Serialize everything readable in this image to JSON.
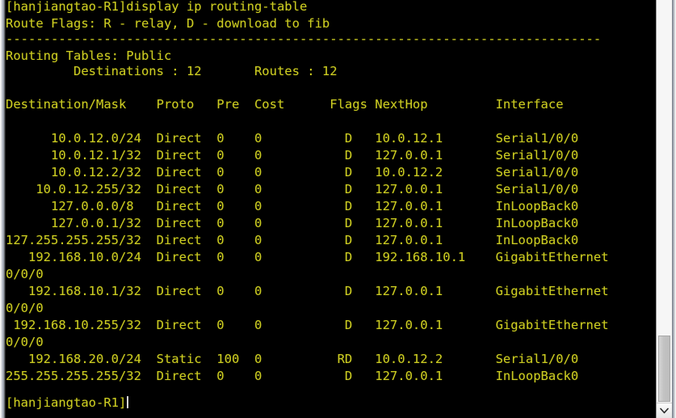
{
  "window": {
    "background_color": "#000000",
    "text_color": "#cccc22",
    "scrollbar_face_color": "#c2c2c2"
  },
  "console": {
    "prompt_command_line": "[hanjiangtao-R1]display ip routing-table",
    "route_flags_line": "Route Flags: R - relay, D - download to fib",
    "separator_line": "-------------------------------------------------------------------------------",
    "routing_tables_line": "Routing Tables: Public",
    "summary_line": "         Destinations : 12       Routes : 12",
    "header_line": "Destination/Mask    Proto   Pre  Cost      Flags NextHop         Interface",
    "trailing_prompt": "[hanjiangtao-R1]",
    "body_lines": [
      "      10.0.12.0/24  Direct  0    0           D   10.0.12.1       Serial1/0/0",
      "      10.0.12.1/32  Direct  0    0           D   127.0.0.1       Serial1/0/0",
      "      10.0.12.2/32  Direct  0    0           D   10.0.12.2       Serial1/0/0",
      "    10.0.12.255/32  Direct  0    0           D   127.0.0.1       Serial1/0/0",
      "      127.0.0.0/8   Direct  0    0           D   127.0.0.1       InLoopBack0",
      "      127.0.0.1/32  Direct  0    0           D   127.0.0.1       InLoopBack0",
      "127.255.255.255/32  Direct  0    0           D   127.0.0.1       InLoopBack0",
      "   192.168.10.0/24  Direct  0    0           D   192.168.10.1    GigabitEthernet",
      "0/0/0",
      "   192.168.10.1/32  Direct  0    0           D   127.0.0.1       GigabitEthernet",
      "0/0/0",
      " 192.168.10.255/32  Direct  0    0           D   127.0.0.1       GigabitEthernet",
      "0/0/0",
      "   192.168.20.0/24  Static  100  0          RD   10.0.12.2       Serial1/0/0",
      "255.255.255.255/32  Direct  0    0           D   127.0.0.1       InLoopBack0"
    ]
  },
  "routing_table": {
    "columns": [
      "Destination/Mask",
      "Proto",
      "Pre",
      "Cost",
      "Flags",
      "NextHop",
      "Interface"
    ],
    "destinations_count": "12",
    "routes_count": "12",
    "rows": [
      {
        "destination": "10.0.12.0/24",
        "proto": "Direct",
        "pre": "0",
        "cost": "0",
        "flags": "D",
        "nexthop": "10.0.12.1",
        "interface": "Serial1/0/0"
      },
      {
        "destination": "10.0.12.1/32",
        "proto": "Direct",
        "pre": "0",
        "cost": "0",
        "flags": "D",
        "nexthop": "127.0.0.1",
        "interface": "Serial1/0/0"
      },
      {
        "destination": "10.0.12.2/32",
        "proto": "Direct",
        "pre": "0",
        "cost": "0",
        "flags": "D",
        "nexthop": "10.0.12.2",
        "interface": "Serial1/0/0"
      },
      {
        "destination": "10.0.12.255/32",
        "proto": "Direct",
        "pre": "0",
        "cost": "0",
        "flags": "D",
        "nexthop": "127.0.0.1",
        "interface": "Serial1/0/0"
      },
      {
        "destination": "127.0.0.0/8",
        "proto": "Direct",
        "pre": "0",
        "cost": "0",
        "flags": "D",
        "nexthop": "127.0.0.1",
        "interface": "InLoopBack0"
      },
      {
        "destination": "127.0.0.1/32",
        "proto": "Direct",
        "pre": "0",
        "cost": "0",
        "flags": "D",
        "nexthop": "127.0.0.1",
        "interface": "InLoopBack0"
      },
      {
        "destination": "127.255.255.255/32",
        "proto": "Direct",
        "pre": "0",
        "cost": "0",
        "flags": "D",
        "nexthop": "127.0.0.1",
        "interface": "InLoopBack0"
      },
      {
        "destination": "192.168.10.0/24",
        "proto": "Direct",
        "pre": "0",
        "cost": "0",
        "flags": "D",
        "nexthop": "192.168.10.1",
        "interface": "GigabitEthernet0/0/0"
      },
      {
        "destination": "192.168.10.1/32",
        "proto": "Direct",
        "pre": "0",
        "cost": "0",
        "flags": "D",
        "nexthop": "127.0.0.1",
        "interface": "GigabitEthernet0/0/0"
      },
      {
        "destination": "192.168.10.255/32",
        "proto": "Direct",
        "pre": "0",
        "cost": "0",
        "flags": "D",
        "nexthop": "127.0.0.1",
        "interface": "GigabitEthernet0/0/0"
      },
      {
        "destination": "192.168.20.0/24",
        "proto": "Static",
        "pre": "100",
        "cost": "0",
        "flags": "RD",
        "nexthop": "10.0.12.2",
        "interface": "Serial1/0/0"
      },
      {
        "destination": "255.255.255.255/32",
        "proto": "Direct",
        "pre": "0",
        "cost": "0",
        "flags": "D",
        "nexthop": "127.0.0.1",
        "interface": "InLoopBack0"
      }
    ]
  },
  "scrollbar": {
    "down_arrow_icon": "chevron-down-icon"
  }
}
